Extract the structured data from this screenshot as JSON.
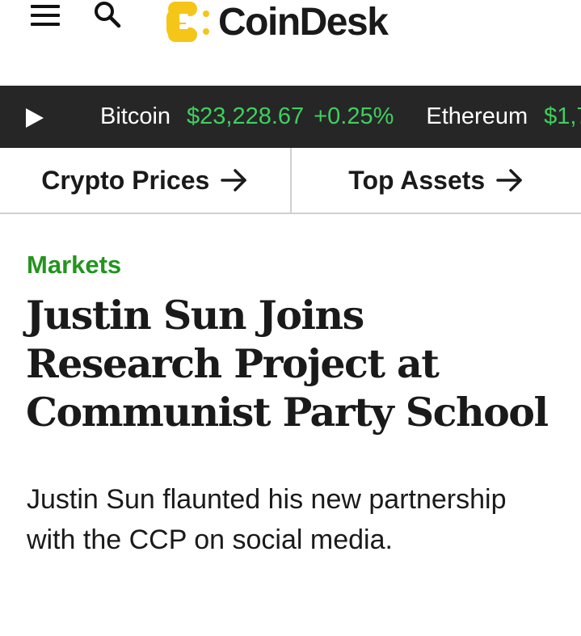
{
  "header": {
    "logo_text": "CoinDesk",
    "menu_icon": "hamburger-menu-icon",
    "search_icon": "search-icon",
    "logo_colors": {
      "primary": "#f5c518",
      "dark": "#1a1a1a"
    }
  },
  "ticker": {
    "play_icon": "play-icon",
    "items": [
      {
        "name": "Bitcoin",
        "price": "$23,228.67",
        "change": "+0.25%"
      },
      {
        "name": "Ethereum",
        "price": "$1,7",
        "change": ""
      }
    ],
    "colors": {
      "background": "#262626",
      "positive": "#3fcf5e"
    }
  },
  "quick_links": [
    {
      "label": "Crypto Prices",
      "icon": "arrow-right-icon"
    },
    {
      "label": "Top Assets",
      "icon": "arrow-right-icon"
    }
  ],
  "article": {
    "category": "Markets",
    "headline": "Justin Sun Joins Research Project at Communist Party School",
    "dek": "Justin Sun flaunted his new partnership with the CCP on social media.",
    "colors": {
      "category": "#23941f"
    }
  }
}
